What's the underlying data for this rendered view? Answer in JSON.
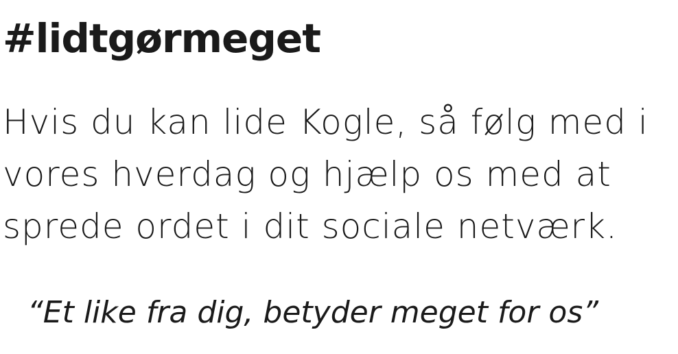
{
  "hashtag": "#lidtgørmeget",
  "body": {
    "lines": [
      "Hvis du kan lide Kogle, så følg med i",
      "vores hverdag og hjælp os med at",
      "sprede ordet i dit sociale netværk."
    ]
  },
  "quote": "“Et like fra dig, betyder meget for os”"
}
